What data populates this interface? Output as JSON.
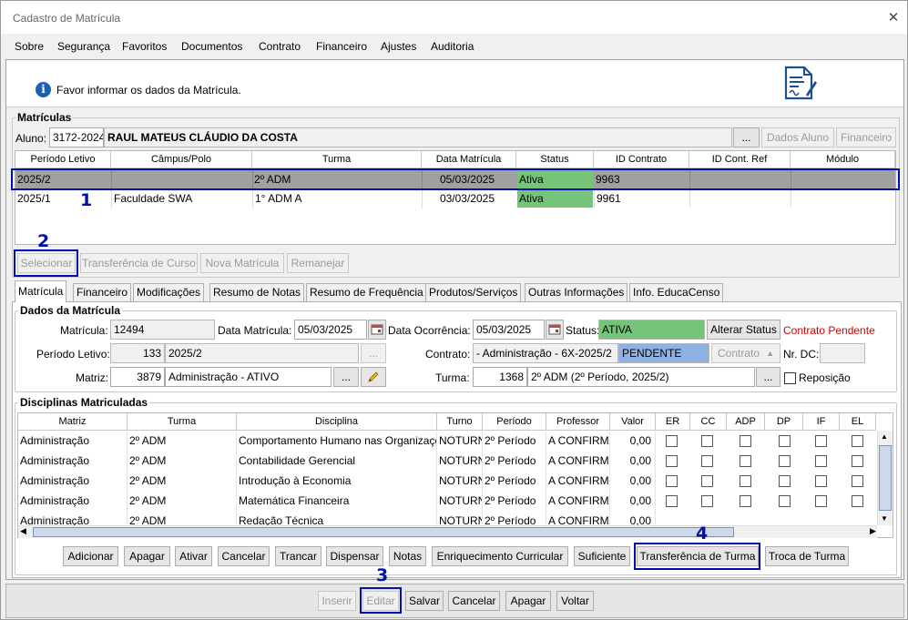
{
  "window": {
    "title": "Cadastro de Matrícula",
    "close_glyph": "✕"
  },
  "menu": [
    "Sobre",
    "Segurança",
    "Favoritos",
    "Documentos",
    "Contrato",
    "Financeiro",
    "Ajustes",
    "Auditoria"
  ],
  "info": {
    "icon": "info-icon",
    "text": "Favor informar os dados da Matrícula.",
    "doc_icon": "document-signature-icon"
  },
  "matriculas": {
    "group_label": "Matrículas",
    "aluno_label": "Aluno:",
    "aluno_code": "3172-2024",
    "aluno_name": "RAUL MATEUS CLÁUDIO DA COSTA",
    "ellipsis": "...",
    "dados_aluno": "Dados Aluno",
    "financeiro": "Financeiro",
    "columns": [
      "Período Letivo",
      "Câmpus/Polo",
      "Turma",
      "Data Matrícula",
      "Status",
      "ID Contrato",
      "ID Cont. Ref",
      "Módulo"
    ],
    "rows": [
      {
        "periodo": "2025/2",
        "campus": "",
        "turma": "2º ADM",
        "data": "05/03/2025",
        "status": "Ativa",
        "id_contrato": "9963",
        "id_ref": "",
        "modulo": ""
      },
      {
        "periodo": "2025/1",
        "campus": "Faculdade SWA",
        "turma": "1° ADM A",
        "data": "03/03/2025",
        "status": "Ativa",
        "id_contrato": "9961",
        "id_ref": "",
        "modulo": ""
      }
    ],
    "buttons": {
      "selecionar": "Selecionar",
      "transferencia_curso": "Transferência de Curso",
      "nova_matricula": "Nova Matrícula",
      "remanejar": "Remanejar"
    }
  },
  "tabs": [
    "Matrícula",
    "Financeiro",
    "Modificações",
    "Resumo de Notas",
    "Resumo de Frequência",
    "Produtos/Serviços",
    "Outras Informações",
    "Info. EducaCenso"
  ],
  "dados": {
    "group_label": "Dados da Matrícula",
    "matricula_label": "Matrícula:",
    "matricula": "12494",
    "data_matricula_label": "Data Matrícula:",
    "data_matricula": "05/03/2025",
    "data_ocorrencia_label": "Data Ocorrência:",
    "data_ocorrencia": "05/03/2025",
    "status_label": "Status:",
    "status": "ATIVA",
    "alterar_status": "Alterar Status",
    "contrato_pendente": "Contrato Pendente",
    "periodo_label": "Período Letivo:",
    "periodo_code": "133",
    "periodo": "2025/2",
    "contrato_label": "Contrato:",
    "contrato": "- Administração - 6X-2025/2",
    "contrato_status": "PENDENTE",
    "contrato_btn": "Contrato",
    "nr_dc_label": "Nr. DC:",
    "matriz_label": "Matriz:",
    "matriz_code": "3879",
    "matriz": "Administração - ATIVO",
    "turma_label": "Turma:",
    "turma_code": "1368",
    "turma": "2º ADM (2º Período, 2025/2)",
    "reposicao_label": "Reposição",
    "ellipsis": "..."
  },
  "disciplinas": {
    "group_label": "Disciplinas Matriculadas",
    "columns": [
      "Matriz",
      "Turma",
      "Disciplina",
      "Turno",
      "Período",
      "Professor",
      "Valor",
      "ER",
      "CC",
      "ADP",
      "DP",
      "IF",
      "EL"
    ],
    "rows": [
      {
        "matriz": "Administração",
        "turma": "2º ADM",
        "disciplina": "Comportamento Humano nas Organizações",
        "turno": "NOTURNO",
        "periodo": "2º Período",
        "professor": "A CONFIRMAR",
        "valor": "0,00"
      },
      {
        "matriz": "Administração",
        "turma": "2º ADM",
        "disciplina": "Contabilidade Gerencial",
        "turno": "NOTURNO",
        "periodo": "2º Período",
        "professor": "A CONFIRMAR",
        "valor": "0,00"
      },
      {
        "matriz": "Administração",
        "turma": "2º ADM",
        "disciplina": "Introdução à Economia",
        "turno": "NOTURNO",
        "periodo": "2º Período",
        "professor": "A CONFIRMAR",
        "valor": "0,00"
      },
      {
        "matriz": "Administração",
        "turma": "2º ADM",
        "disciplina": "Matemática Financeira",
        "turno": "NOTURNO",
        "periodo": "2º Período",
        "professor": "A CONFIRMAR",
        "valor": "0,00"
      },
      {
        "matriz": "Administração",
        "turma": "2º ADM",
        "disciplina": "Redação Técnica",
        "turno": "NOTURNO",
        "periodo": "2º Período",
        "professor": "A CONFIRMAR",
        "valor": "0,00"
      }
    ],
    "buttons": [
      "Adicionar",
      "Apagar",
      "Ativar",
      "Cancelar",
      "Trancar",
      "Dispensar",
      "Notas",
      "Enriquecimento Curricular",
      "Suficiente",
      "Transferência de Turma",
      "Troca de Turma"
    ]
  },
  "bottom": {
    "inserir": "Inserir",
    "editar": "Editar",
    "salvar": "Salvar",
    "cancelar": "Cancelar",
    "apagar": "Apagar",
    "voltar": "Voltar"
  },
  "annotations": {
    "n1": "1",
    "n2": "2",
    "n3": "3",
    "n4": "4",
    "color": "#0010b0"
  },
  "colors": {
    "status_green": "#76c47a",
    "pendente_blue": "#8eb1e4",
    "contrato_pendente_red": "#d00000",
    "selected_row": "#a0a0a0"
  }
}
